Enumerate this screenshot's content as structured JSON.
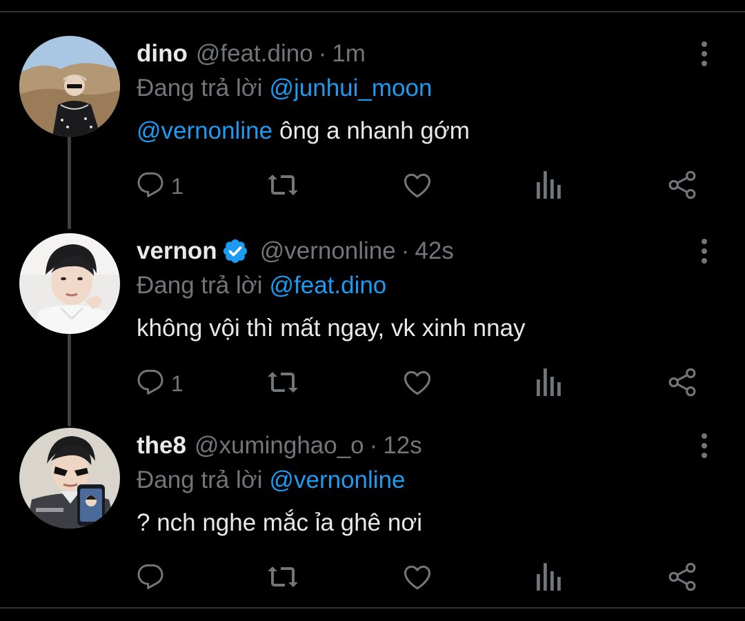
{
  "colors": {
    "background": "#000000",
    "text": "#e7e9ea",
    "muted": "#71767b",
    "link": "#1d9bf0",
    "verified": "#1d9bf0",
    "divider": "#2f3336"
  },
  "reply_prefix": "Đang trả lời",
  "tweets": [
    {
      "display_name": "dino",
      "verified": false,
      "handle": "@feat.dino",
      "separator": "·",
      "time": "1m",
      "replying_to": "@junhui_moon",
      "body_mention": "@vernonline",
      "body_text": "ông a nhanh gớm",
      "reply_count": "1",
      "icons": [
        "reply-icon",
        "retweet-icon",
        "like-icon",
        "views-icon",
        "share-icon",
        "more-icon"
      ]
    },
    {
      "display_name": "vernon",
      "verified": true,
      "handle": "@vernonline",
      "separator": "·",
      "time": "42s",
      "replying_to": "@feat.dino",
      "body_mention": "",
      "body_text": "không vội thì mất ngay, vk xinh nnay",
      "reply_count": "1",
      "icons": [
        "reply-icon",
        "retweet-icon",
        "like-icon",
        "views-icon",
        "share-icon",
        "more-icon"
      ]
    },
    {
      "display_name": "the8",
      "verified": false,
      "handle": "@xuminghao_o",
      "separator": "·",
      "time": "12s",
      "replying_to": "@vernonline",
      "body_mention": "",
      "body_text": "? nch nghe mắc ỉa ghê nơi",
      "reply_count": "",
      "icons": [
        "reply-icon",
        "retweet-icon",
        "like-icon",
        "views-icon",
        "share-icon",
        "more-icon"
      ]
    }
  ]
}
